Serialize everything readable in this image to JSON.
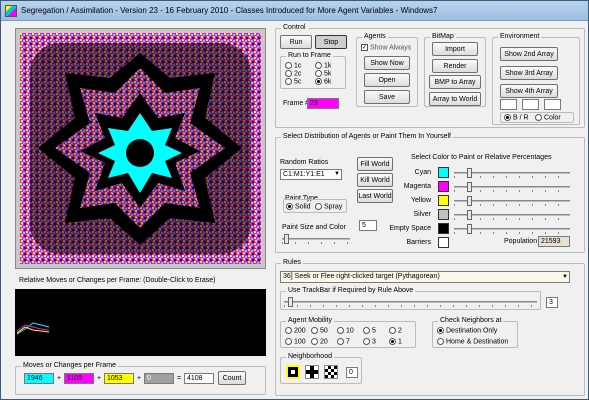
{
  "window": {
    "title": "Segregation / Assimilation - Version 23 - 16 February 2010 - Classes Introduced for More Agent Variables - Windows7"
  },
  "graph": {
    "caption": "Relative Moves or Changes per Frame:  (Double-Click to Erase)"
  },
  "moves": {
    "group_label": "Moves or Changes per Frame",
    "cyan": "1946",
    "magenta": "1109",
    "yellow": "1053",
    "gray": "0",
    "total": "4108",
    "plus": "+",
    "equals": "=",
    "count_button": "Count",
    "colors": {
      "cyan": "#00ffff",
      "magenta": "#ff00ff",
      "yellow": "#ffff00",
      "gray": "#a0a0a0"
    }
  },
  "control": {
    "group_label": "Control",
    "run": "Run",
    "stop": "Stop",
    "run_to_frame": {
      "label": "Run to Frame",
      "options": [
        "1c",
        "1k",
        "2c",
        "5k",
        "5c",
        "6k"
      ],
      "selected": "6k"
    },
    "frame_label": "Frame #",
    "frame_value": "23"
  },
  "agents": {
    "group_label": "Agents",
    "show_always": "Show Always",
    "show_always_checked": true,
    "show_now": "Show Now",
    "open": "Open",
    "save": "Save"
  },
  "bitmap": {
    "group_label": "BitMap",
    "import": "Import",
    "render": "Render",
    "bmp_to_array": "BMP to Array",
    "array_to_world": "Array to World"
  },
  "environment": {
    "group_label": "Environment",
    "show2": "Show 2nd Array",
    "show3": "Show 3rd Array",
    "show4": "Show 4th Array",
    "bw": "B / R",
    "color": "Color",
    "selected": "B / R"
  },
  "distribution": {
    "group_label": "Select Distribution of Agents or Paint Them In Yourself",
    "random_ratios": "Random Ratios",
    "ratio_value": "C1:M1:Y1:E1",
    "fill_world": "Fill World",
    "kill_world": "Kill World",
    "last_world": "Last World",
    "paint_type": "Paint Type",
    "solid": "Solid",
    "spray": "Spray",
    "paint_selected": "Solid",
    "paint_size_label": "Paint Size and Color",
    "paint_size": "5",
    "select_color_label": "Select Color to Paint or Relative Percentages",
    "colors": [
      {
        "label": "Cyan",
        "hex": "#00ffff",
        "level": 0.12
      },
      {
        "label": "Magenta",
        "hex": "#ff00ff",
        "level": 0.12
      },
      {
        "label": "Yellow",
        "hex": "#ffff00",
        "level": 0.12
      },
      {
        "label": "Silver",
        "hex": "#c0c0c0",
        "level": 0.12
      },
      {
        "label": "Empty Space",
        "hex": "#000000",
        "level": 0.12
      },
      {
        "label": "Barriers",
        "hex": "#ffffff",
        "level": 0
      }
    ],
    "population_label": "Population",
    "population": "21593"
  },
  "rules": {
    "group_label": "Rules",
    "rule": "36] Seek or Flee right-clicked target (Pythagorean)",
    "trackbar_label": "Use TrackBar if Required by Rule Above",
    "trackbar_value": "3",
    "mobility_label": "Agent Mobility",
    "mobility_options": [
      "200",
      "50",
      "10",
      "5",
      "2",
      "100",
      "20",
      "7",
      "3",
      "1"
    ],
    "mobility_selected": "1",
    "neighbors_label": "Check Neighbors at",
    "dest_only": "Destination Only",
    "home_dest": "Home & Destination",
    "neighbors_selected": "Destination Only",
    "neighborhood_label": "Neighborhood",
    "neighborhood_value": "0"
  }
}
